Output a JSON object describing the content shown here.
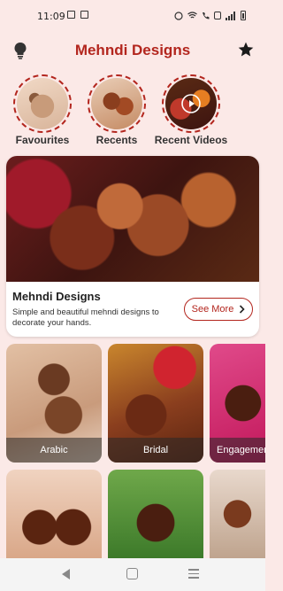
{
  "status": {
    "time": "11:09"
  },
  "header": {
    "title": "Mehndi Designs"
  },
  "quick_access": [
    {
      "label": "Favourites"
    },
    {
      "label": "Recents"
    },
    {
      "label": "Recent Videos"
    }
  ],
  "feature": {
    "title": "Mehndi Designs",
    "description": "Simple and beautiful mehndi designs to decorate your hands.",
    "button_label": "See More"
  },
  "categories": [
    {
      "label": "Arabic"
    },
    {
      "label": "Bridal"
    },
    {
      "label": "Engagement"
    }
  ],
  "colors": {
    "accent": "#b3261e",
    "background": "#fbe9e7"
  }
}
